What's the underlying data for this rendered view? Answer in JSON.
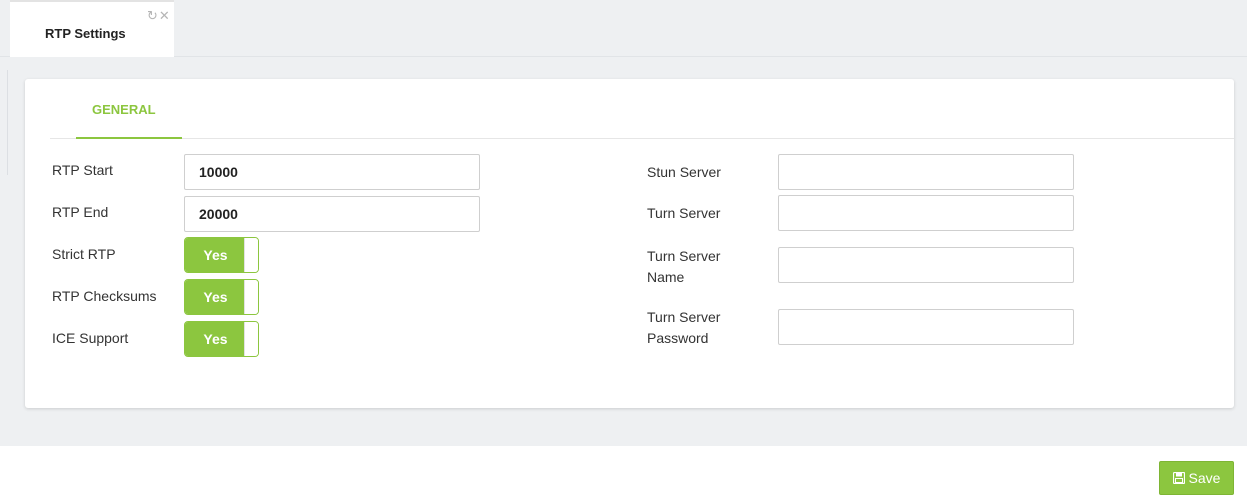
{
  "tab": {
    "title": "RTP Settings",
    "refresh_icon": "refresh-icon",
    "close_icon": "close-icon"
  },
  "section_tab": "GENERAL",
  "fields": {
    "rtp_start": {
      "label": "RTP Start",
      "value": "10000"
    },
    "rtp_end": {
      "label": "RTP End",
      "value": "20000"
    },
    "strict_rtp": {
      "label": "Strict RTP",
      "state": "Yes"
    },
    "rtp_checksums": {
      "label": "RTP Checksums",
      "state": "Yes"
    },
    "ice_support": {
      "label": "ICE Support",
      "state": "Yes"
    },
    "stun_server": {
      "label": "Stun Server",
      "value": ""
    },
    "turn_server": {
      "label": "Turn Server",
      "value": ""
    },
    "turn_server_name": {
      "label_line1": "Turn Server",
      "label_line2": "Name",
      "value": ""
    },
    "turn_server_password": {
      "label_line1": "Turn Server",
      "label_line2": "Password",
      "value": ""
    }
  },
  "actions": {
    "save_label": "Save",
    "save_icon": "floppy-disk-icon"
  },
  "colors": {
    "accent": "#8cc63f",
    "background": "#eef0f2"
  }
}
